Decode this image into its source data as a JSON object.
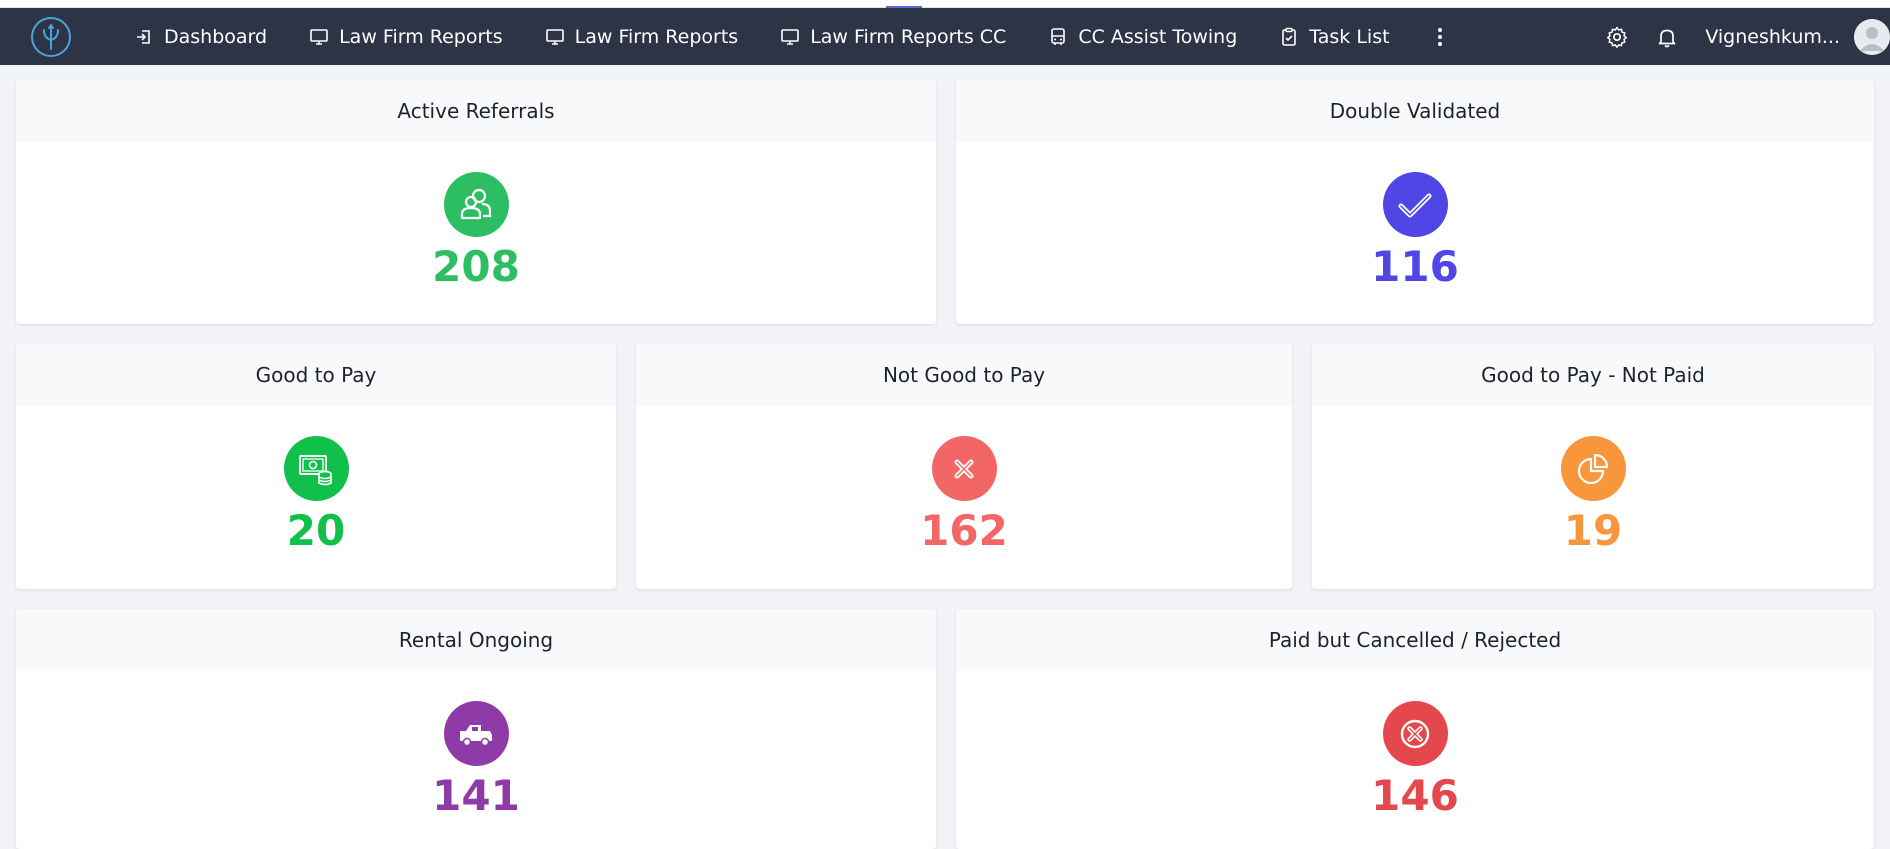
{
  "nav": {
    "items": [
      {
        "label": "Dashboard",
        "icon": "sign-in-icon"
      },
      {
        "label": "Law Firm Reports",
        "icon": "monitor-icon"
      },
      {
        "label": "Law Firm Reports",
        "icon": "monitor-icon"
      },
      {
        "label": "Law Firm Reports CC",
        "icon": "monitor-icon"
      },
      {
        "label": "CC Assist Towing",
        "icon": "bus-icon"
      },
      {
        "label": "Task List",
        "icon": "clipboard-icon"
      }
    ],
    "username": "Vigneshkum..."
  },
  "cards": {
    "active_referrals": {
      "title": "Active Referrals",
      "value": "208",
      "color": "#2dbe64"
    },
    "double_validated": {
      "title": "Double Validated",
      "value": "116",
      "color": "#4f46e5"
    },
    "good_to_pay": {
      "title": "Good to Pay",
      "value": "20",
      "color": "#11bf4b"
    },
    "not_good_to_pay": {
      "title": "Not Good to Pay",
      "value": "162",
      "color": "#f26666"
    },
    "good_to_pay_not_paid": {
      "title": "Good to Pay - Not Paid",
      "value": "19",
      "color": "#f7963b"
    },
    "rental_ongoing": {
      "title": "Rental Ongoing",
      "value": "141",
      "color": "#8e3ba8"
    },
    "paid_but_cancelled": {
      "title": "Paid but Cancelled / Rejected",
      "value": "146",
      "color": "#e4474c"
    }
  },
  "colors": {
    "navbar": "#2c3446",
    "page_bg": "#f1f3f7"
  }
}
